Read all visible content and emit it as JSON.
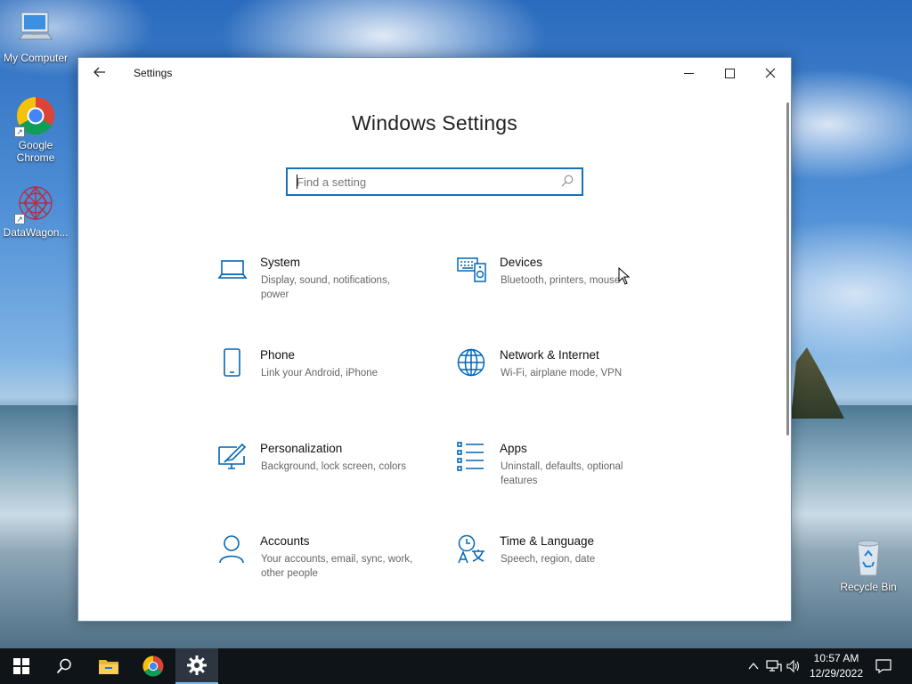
{
  "desktop": {
    "icons": [
      {
        "label": "My Computer",
        "icon": "computer-icon"
      },
      {
        "label": "Google Chrome",
        "icon": "chrome-icon"
      },
      {
        "label": "DataWagon...",
        "icon": "datawagon-icon"
      },
      {
        "label": "Recycle Bin",
        "icon": "recycle-bin-icon"
      }
    ]
  },
  "window": {
    "title": "Settings",
    "heading": "Windows Settings",
    "search_placeholder": "Find a setting",
    "accent_color": "#0067b8",
    "tiles": [
      {
        "title": "System",
        "description": "Display, sound, notifications, power",
        "icon": "laptop-icon"
      },
      {
        "title": "Devices",
        "description": "Bluetooth, printers, mouse",
        "icon": "devices-icon"
      },
      {
        "title": "Phone",
        "description": "Link your Android, iPhone",
        "icon": "phone-icon"
      },
      {
        "title": "Network & Internet",
        "description": "Wi-Fi, airplane mode, VPN",
        "icon": "globe-icon"
      },
      {
        "title": "Personalization",
        "description": "Background, lock screen, colors",
        "icon": "personalization-icon"
      },
      {
        "title": "Apps",
        "description": "Uninstall, defaults, optional features",
        "icon": "apps-list-icon"
      },
      {
        "title": "Accounts",
        "description": "Your accounts, email, sync, work, other people",
        "icon": "person-icon"
      },
      {
        "title": "Time & Language",
        "description": "Speech, region, date",
        "icon": "time-language-icon"
      }
    ]
  },
  "taskbar": {
    "apps": [
      "start-icon",
      "search-icon",
      "file-explorer-icon",
      "chrome-icon",
      "settings-gear-icon"
    ],
    "active_app": "settings-gear-icon",
    "time": "10:57 AM",
    "date": "12/29/2022"
  }
}
